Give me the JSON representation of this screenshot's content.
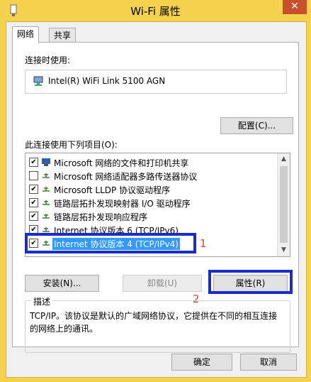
{
  "window": {
    "title": "Wi-Fi 属性",
    "close_glyph": "✕"
  },
  "tabs": [
    {
      "label": "网络"
    },
    {
      "label": "共享"
    }
  ],
  "connect_using_label": "连接时使用:",
  "adapter_name": "Intel(R) WiFi Link 5100 AGN",
  "configure_button": "配置(C)...",
  "items_label": "此连接使用下列项目(O):",
  "items": [
    {
      "checked": true,
      "label": "Microsoft 网络的文件和打印机共享",
      "icon": "network-share-icon"
    },
    {
      "checked": false,
      "label": "Microsoft 网络适配器多路传送器协议",
      "icon": "protocol-icon"
    },
    {
      "checked": true,
      "label": "Microsoft LLDP 协议驱动程序",
      "icon": "protocol-icon"
    },
    {
      "checked": true,
      "label": "链路层拓扑发现映射器 I/O 驱动程序",
      "icon": "protocol-icon"
    },
    {
      "checked": true,
      "label": "链路层拓扑发现响应程序",
      "icon": "protocol-icon"
    },
    {
      "checked": true,
      "label": "Internet 协议版本 6 (TCP/IPv6)",
      "icon": "protocol-icon"
    },
    {
      "checked": true,
      "label": "Internet 协议版本 4 (TCP/IPv4)",
      "icon": "protocol-icon",
      "selected": true
    }
  ],
  "install_button": "安装(N)...",
  "uninstall_button": "卸载(U)",
  "properties_button": "属性(R)",
  "annotations": {
    "one": "1",
    "two": "2"
  },
  "description_title": "描述",
  "description_text": "TCP/IP。该协议是默认的广域网络协议，它提供在不同的相互连接的网络上的通讯。",
  "ok_button": "确定",
  "cancel_button": "取消",
  "colors": {
    "title_bar": "#f5d24e",
    "highlight_box": "#1c2cc8",
    "annotation": "#d9442a",
    "selection": "#3399ff"
  }
}
